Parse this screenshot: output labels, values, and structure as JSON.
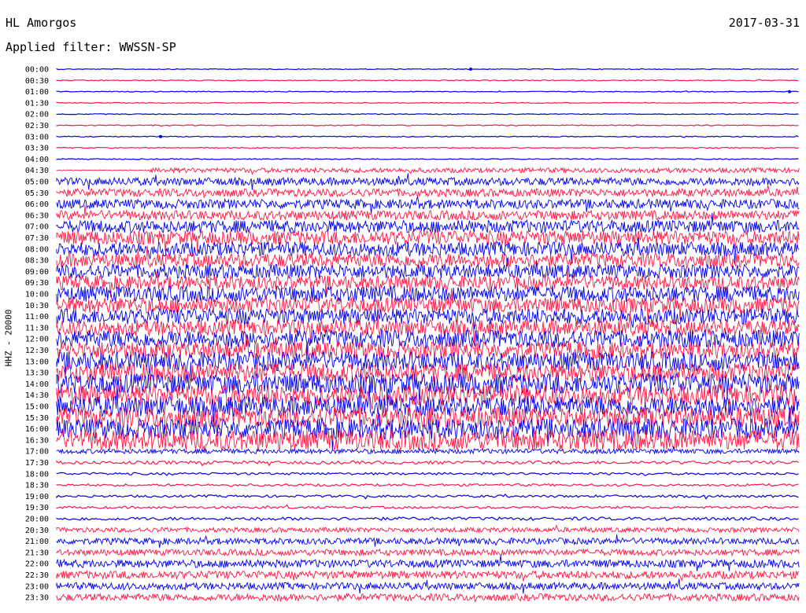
{
  "header": {
    "station": "HL Amorgos",
    "date": "2017-03-31",
    "filter": "Applied filter: WWSSN-SP"
  },
  "axis": {
    "channel_label": "HHZ - 20000"
  },
  "colors": {
    "trace_a": "#0000ee",
    "trace_b": "#ff1744",
    "background": "#ffffff",
    "text": "#000000"
  },
  "chart_data": {
    "type": "line",
    "title": "HL Amorgos",
    "subtitle": "Applied filter: WWSSN-SP",
    "ylabel": "HHZ - 20000",
    "date": "2017-03-31",
    "row_labels": [
      "00:00",
      "00:30",
      "01:00",
      "01:30",
      "02:00",
      "02:30",
      "03:00",
      "03:30",
      "04:00",
      "04:30",
      "05:00",
      "05:30",
      "06:00",
      "06:30",
      "07:00",
      "07:30",
      "08:00",
      "08:30",
      "09:00",
      "09:30",
      "10:00",
      "10:30",
      "11:00",
      "11:30",
      "12:00",
      "12:30",
      "13:00",
      "13:30",
      "14:00",
      "14:30",
      "15:00",
      "15:30",
      "16:00",
      "16:30",
      "17:00",
      "17:30",
      "18:00",
      "18:30",
      "19:00",
      "19:30",
      "20:00",
      "20:30",
      "21:00",
      "21:30",
      "22:00",
      "22:30",
      "23:00",
      "23:30"
    ],
    "trace_colors": [
      "#0000ee",
      "#ff1744"
    ],
    "relative_amplitude": [
      0.5,
      0.6,
      0.5,
      0.5,
      0.5,
      0.6,
      0.6,
      0.6,
      0.6,
      3.0,
      5.0,
      5.0,
      6.0,
      6.0,
      8.0,
      9.0,
      9.0,
      9.0,
      9.0,
      9.0,
      10.0,
      10.0,
      10.0,
      10.0,
      11.0,
      11.0,
      12.0,
      12.0,
      13.0,
      13.0,
      13.0,
      13.0,
      13.0,
      13.0,
      3.0,
      2.0,
      1.5,
      1.5,
      1.5,
      1.5,
      2.0,
      3.0,
      4.0,
      4.0,
      5.0,
      5.0,
      4.5,
      4.5
    ],
    "grid": false
  }
}
